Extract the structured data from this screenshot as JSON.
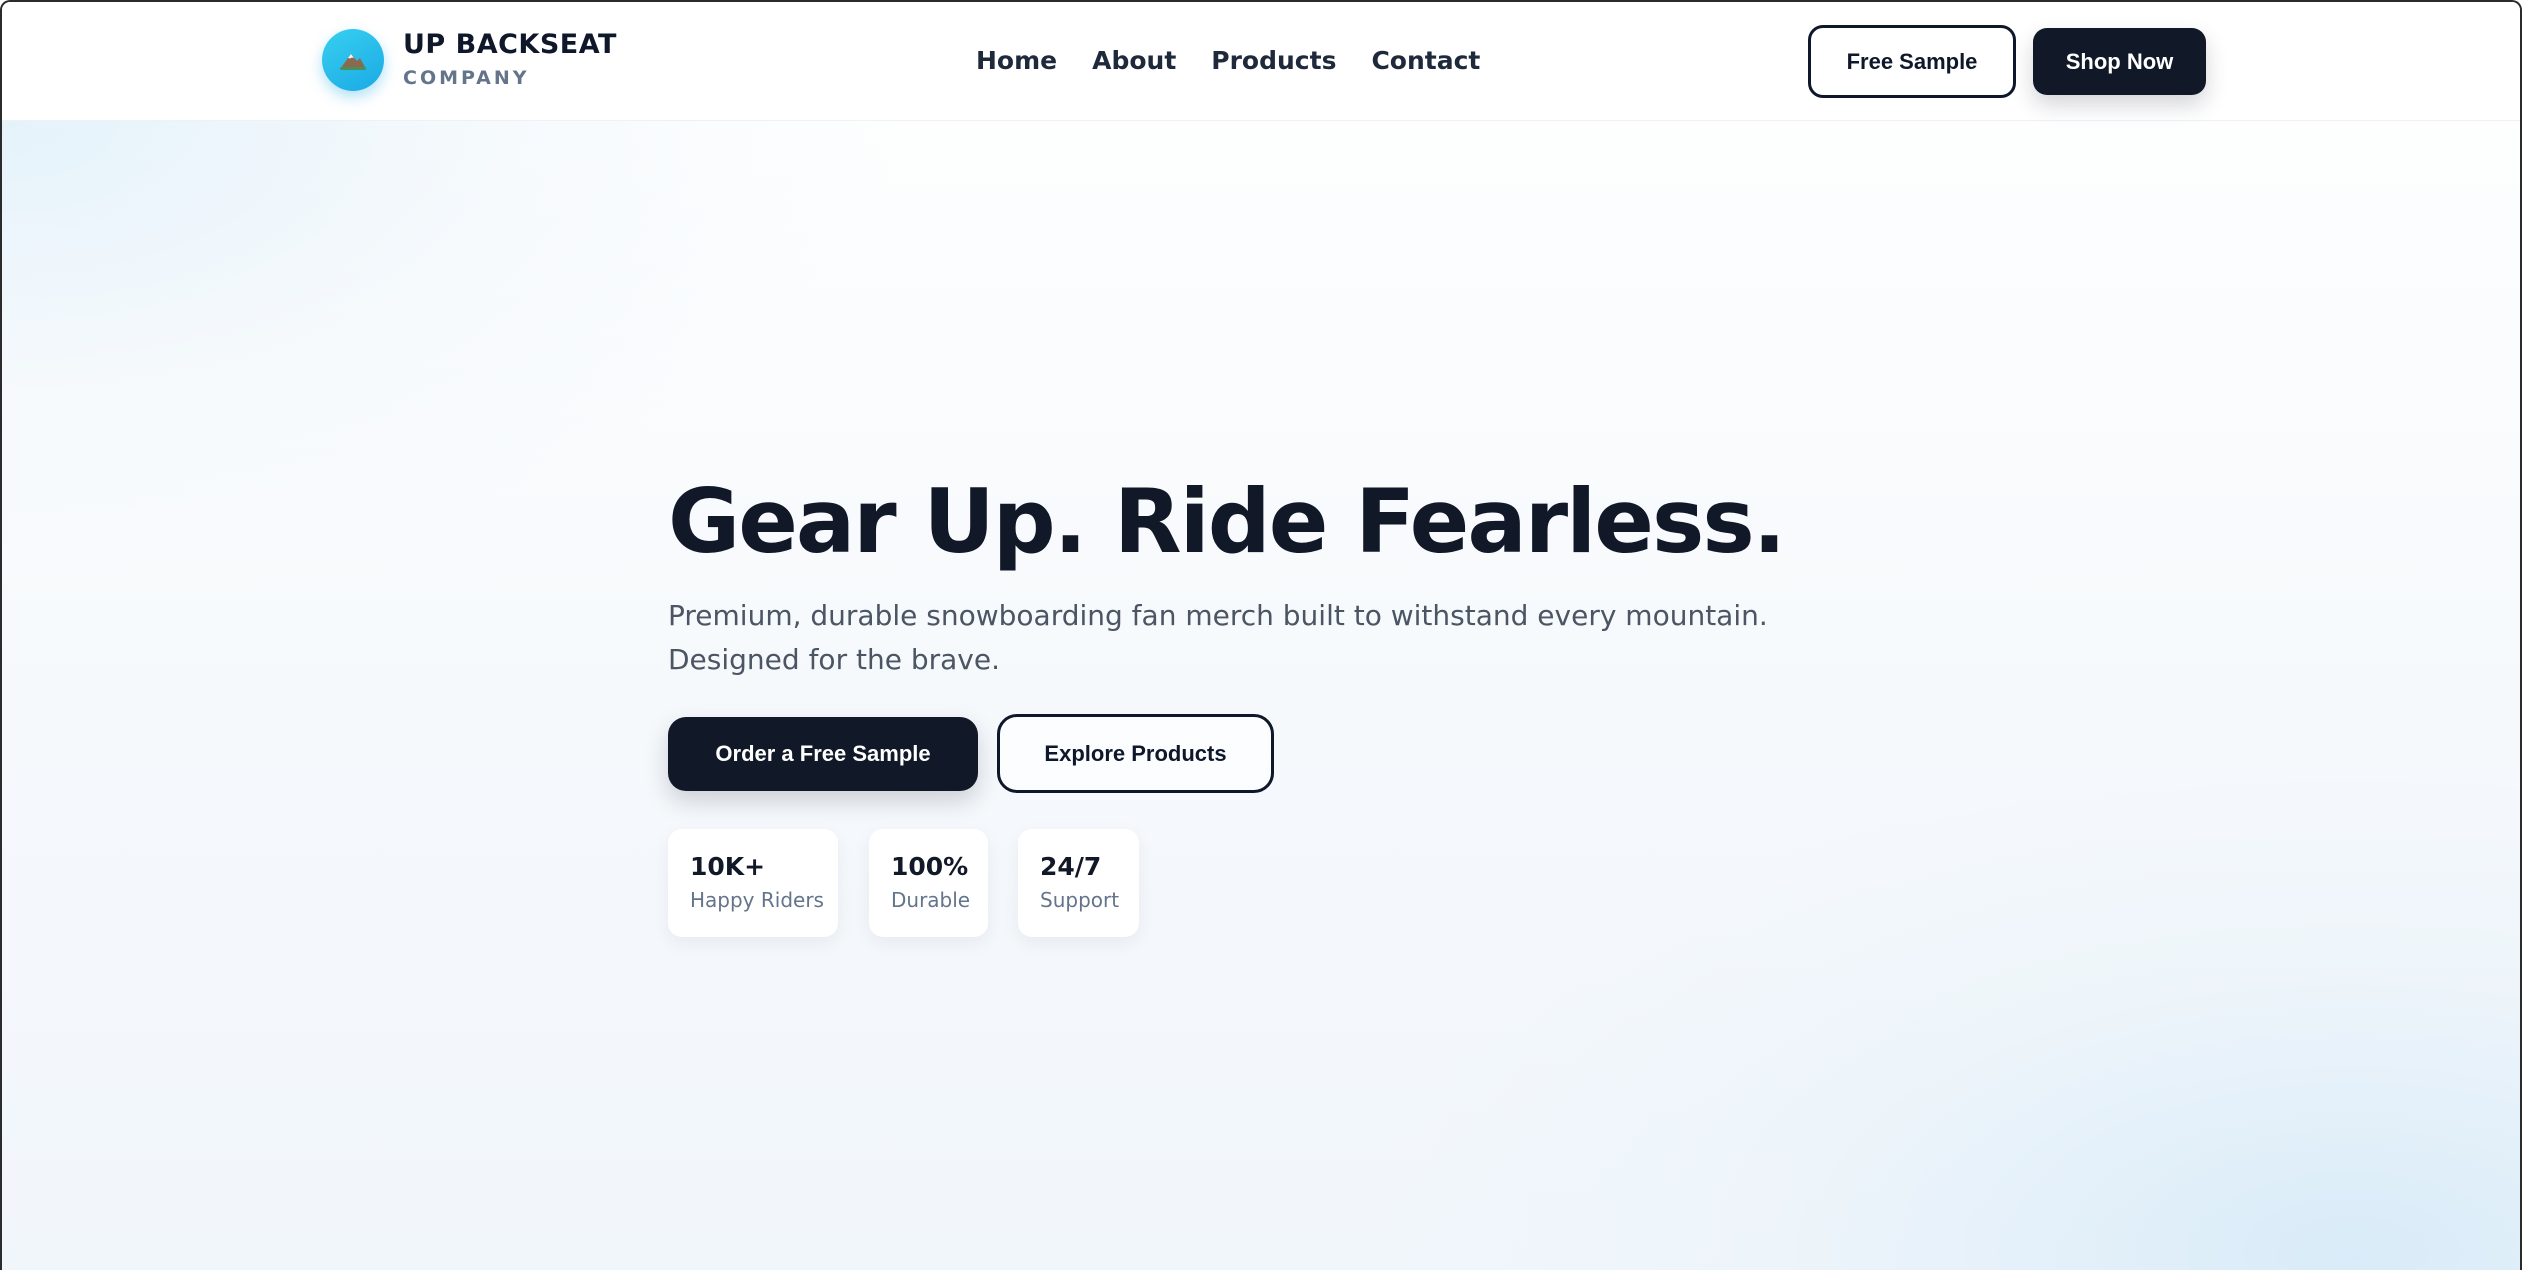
{
  "brand": {
    "name": "UP BACKSEAT",
    "subtitle": "COMPANY",
    "icon": "mountain-icon",
    "accent_color": "#1aa9e4"
  },
  "nav": {
    "items": [
      {
        "label": "Home"
      },
      {
        "label": "About"
      },
      {
        "label": "Products"
      },
      {
        "label": "Contact"
      }
    ]
  },
  "header_actions": {
    "free_sample_label": "Free Sample",
    "shop_now_label": "Shop Now"
  },
  "hero": {
    "title": "Gear Up. Ride Fearless.",
    "subtitle": "Premium, durable snowboarding fan merch built to withstand every mountain. Designed for the brave.",
    "primary_cta": "Order a Free Sample",
    "secondary_cta": "Explore Products"
  },
  "stats": [
    {
      "value": "10K+",
      "label": "Happy Riders"
    },
    {
      "value": "100%",
      "label": "Durable"
    },
    {
      "value": "24/7",
      "label": "Support"
    }
  ],
  "colors": {
    "primary_dark": "#111827",
    "text_muted": "#64748b"
  }
}
